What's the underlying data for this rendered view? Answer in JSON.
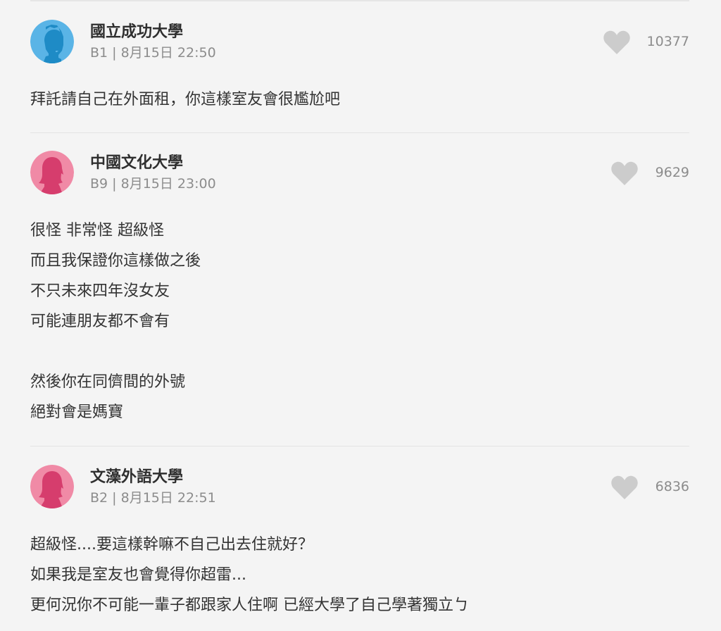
{
  "comments": [
    {
      "school": "國立成功大學",
      "floor": "B1 | 8月15日 22:50",
      "likes": "10377",
      "avatar_icon": "male-avatar-icon",
      "avatar_bg": "#5ab4e6",
      "avatar_fg": "#1e8bc6",
      "lines": [
        "拜託請自己在外面租，你這樣室友會很尷尬吧"
      ]
    },
    {
      "school": "中國文化大學",
      "floor": "B9 | 8月15日 23:00",
      "likes": "9629",
      "avatar_icon": "female-avatar-icon",
      "avatar_bg": "#f08aa6",
      "avatar_fg": "#d63d6d",
      "lines": [
        "很怪 非常怪 超級怪",
        "而且我保證你這樣做之後",
        "不只未來四年沒女友",
        "可能連朋友都不會有",
        "",
        "然後你在同儕間的外號",
        "絕對會是媽寶"
      ]
    },
    {
      "school": "文藻外語大學",
      "floor": "B2 | 8月15日 22:51",
      "likes": "6836",
      "avatar_icon": "female-avatar-icon",
      "avatar_bg": "#f08aa6",
      "avatar_fg": "#d63d6d",
      "lines": [
        "超級怪....要這樣幹嘛不自己出去住就好？",
        "如果我是室友也會覺得你超雷...",
        "更何況你不可能一輩子都跟家人住啊 已經大學了自己學著獨立ㄅ"
      ]
    }
  ],
  "like_icon": "heart-icon",
  "like_color": "#cccccc"
}
